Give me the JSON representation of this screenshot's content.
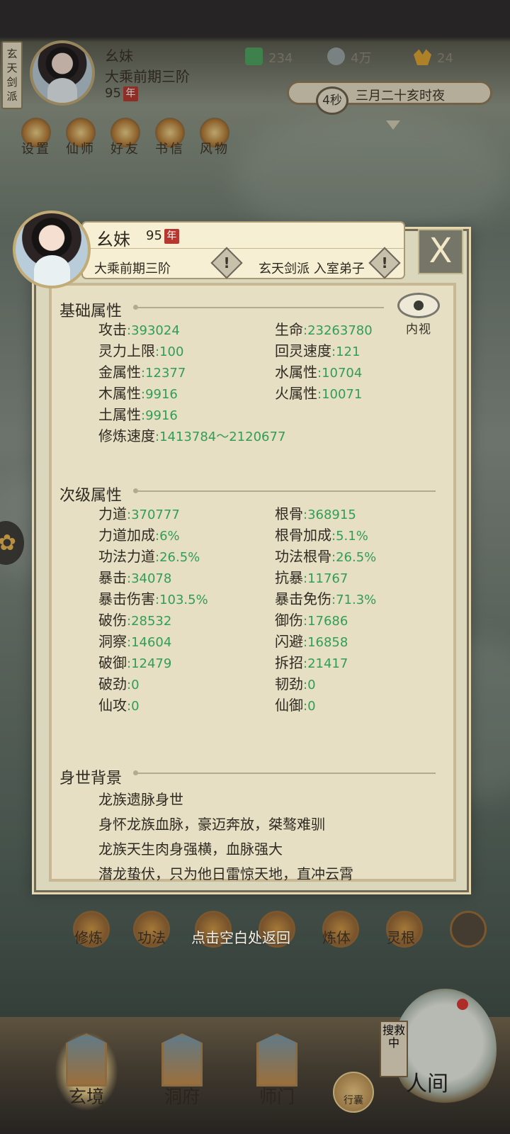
{
  "top": {
    "sect_tab": "玄天剑派",
    "name": "幺妹",
    "rank": "大乘前期三阶",
    "age": "95",
    "age_tag": "年",
    "resources": [
      {
        "value": "234",
        "icon": "jade-leaf-icon"
      },
      {
        "value": "4万",
        "icon": "coin-icon"
      },
      {
        "value": "24",
        "icon": "gold-ingot-icon"
      }
    ],
    "timer": "4秒",
    "time_text": "三月二十亥时夜",
    "menu": [
      {
        "label": "设置",
        "icon": "gear-icon"
      },
      {
        "label": "仙师",
        "icon": "master-icon"
      },
      {
        "label": "好友",
        "icon": "friends-icon"
      },
      {
        "label": "书信",
        "icon": "letter-icon"
      },
      {
        "label": "风物",
        "icon": "scroll-icon"
      }
    ]
  },
  "panel": {
    "name": "幺妹",
    "age": "95",
    "age_tag": "年",
    "rank": "大乘前期三阶",
    "sect": "玄天剑派 入室弟子",
    "warn_symbol": "!",
    "close_symbol": "X",
    "inner_view": "内视",
    "basic_title": "基础属性",
    "basic": [
      {
        "label": "攻击",
        "value": ":393024"
      },
      {
        "label": "生命",
        "value": ":23263780"
      },
      {
        "label": "灵力上限",
        "value": ":100"
      },
      {
        "label": "回灵速度",
        "value": ":121"
      },
      {
        "label": "金属性",
        "value": ":12377"
      },
      {
        "label": "水属性",
        "value": ":10704"
      },
      {
        "label": "木属性",
        "value": ":9916"
      },
      {
        "label": "火属性",
        "value": ":10071"
      },
      {
        "label": "土属性",
        "value": ":9916"
      },
      {
        "label": "修炼速度",
        "value": ":1413784～2120677"
      }
    ],
    "secondary_title": "次级属性",
    "secondary": [
      {
        "label": "力道",
        "value": ":370777"
      },
      {
        "label": "根骨",
        "value": ":368915"
      },
      {
        "label": "力道加成",
        "value": ":6%"
      },
      {
        "label": "根骨加成",
        "value": ":5.1%"
      },
      {
        "label": "功法力道",
        "value": ":26.5%"
      },
      {
        "label": "功法根骨",
        "value": ":26.5%"
      },
      {
        "label": "暴击",
        "value": ":34078"
      },
      {
        "label": "抗暴",
        "value": ":11767"
      },
      {
        "label": "暴击伤害",
        "value": ":103.5%"
      },
      {
        "label": "暴击免伤",
        "value": ":71.3%"
      },
      {
        "label": "破伤",
        "value": ":28532"
      },
      {
        "label": "御伤",
        "value": ":17686"
      },
      {
        "label": "洞察",
        "value": ":14604"
      },
      {
        "label": "闪避",
        "value": ":16858"
      },
      {
        "label": "破御",
        "value": ":12479"
      },
      {
        "label": "拆招",
        "value": ":21417"
      },
      {
        "label": "破劲",
        "value": ":0"
      },
      {
        "label": "韧劲",
        "value": ":0"
      },
      {
        "label": "仙攻",
        "value": ":0"
      },
      {
        "label": "仙御",
        "value": ":0"
      }
    ],
    "background_title": "身世背景",
    "background": [
      "龙族遗脉身世",
      "身怀龙族血脉，豪迈奔放，桀骜难驯",
      "龙族天生肉身强横，血脉强大",
      "潜龙蛰伏，只为他日雷惊天地，直冲云霄"
    ]
  },
  "bottom": {
    "hint": "点击空白处返回",
    "menu": [
      "修炼",
      "功法",
      "",
      "",
      "炼体",
      "灵根"
    ],
    "nav": [
      "玄境",
      "洞府",
      "师门"
    ],
    "pack": "行囊",
    "world": "人间",
    "search": "搜救中"
  }
}
